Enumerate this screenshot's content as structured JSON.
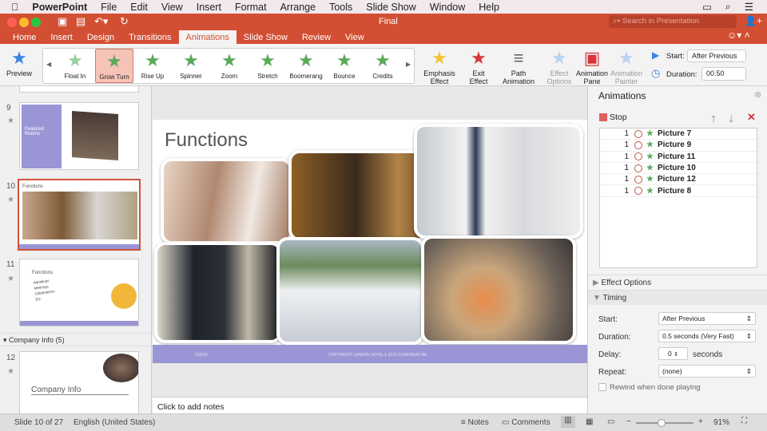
{
  "menubar": {
    "app": "PowerPoint",
    "items": [
      "File",
      "Edit",
      "View",
      "Insert",
      "Format",
      "Arrange",
      "Tools",
      "Slide Show",
      "Window",
      "Help"
    ]
  },
  "window": {
    "title": "Final",
    "search_placeholder": "Search in Presentation"
  },
  "tabs": [
    "Home",
    "Insert",
    "Design",
    "Transitions",
    "Animations",
    "Slide Show",
    "Review",
    "View"
  ],
  "active_tab": "Animations",
  "ribbon": {
    "preview": "Preview",
    "gallery": [
      "Float In",
      "Grow Turn",
      "Rise Up",
      "Spinner",
      "Zoom",
      "Stretch",
      "Boomerang",
      "Bounce",
      "Credits"
    ],
    "selected_effect": "Grow Turn",
    "emphasis": "Emphasis Effect",
    "exit": "Exit Effect",
    "path": "Path Animation",
    "effect_options": "Effect Options",
    "pane": "Animation Pane",
    "painter": "Animation Painter",
    "start_label": "Start:",
    "start_value": "After Previous",
    "duration_label": "Duration:",
    "duration_value": "00.50"
  },
  "thumbs": {
    "s9": {
      "num": "9",
      "title": "Featured Rooms"
    },
    "s10": {
      "num": "10",
      "title": "Functions"
    },
    "s11": {
      "num": "11",
      "title": "Functions",
      "lines": [
        "Weddings",
        "Meetings",
        "Celebrations",
        "Etc"
      ]
    },
    "section": "Company Info (5)",
    "s12": {
      "num": "12",
      "title": "Company Info"
    }
  },
  "slide": {
    "title": "Functions",
    "footer_date": "7/22/15",
    "footer_text": "COPYRIGHT LANDON HOTELS 2015 CONFIDENTIAL"
  },
  "notes": "Click to add notes",
  "pane": {
    "title": "Animations",
    "stop": "Stop",
    "items": [
      {
        "n": "1",
        "name": "Picture 7"
      },
      {
        "n": "1",
        "name": "Picture 9"
      },
      {
        "n": "1",
        "name": "Picture 11"
      },
      {
        "n": "1",
        "name": "Picture 10"
      },
      {
        "n": "1",
        "name": "Picture 12"
      },
      {
        "n": "1",
        "name": "Picture 8"
      }
    ],
    "effect_options": "Effect Options",
    "timing": "Timing",
    "start_label": "Start:",
    "start": "After Previous",
    "duration_label": "Duration:",
    "duration": "0.5 seconds (Very Fast)",
    "delay_label": "Delay:",
    "delay": "0",
    "delay_unit": "seconds",
    "repeat_label": "Repeat:",
    "repeat": "(none)",
    "rewind": "Rewind when done playing"
  },
  "status": {
    "slide": "Slide 10 of 27",
    "lang": "English (United States)",
    "notes": "Notes",
    "comments": "Comments",
    "zoom": "91%",
    "zoom_level": 0.45
  },
  "colors": {
    "accent": "#d24f33",
    "slide_band": "#9a95d4"
  }
}
